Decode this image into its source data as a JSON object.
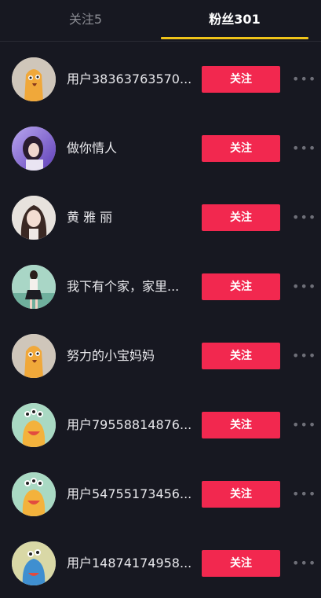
{
  "tabs": {
    "following_label": "关注5",
    "followers_label": "粉丝301"
  },
  "accent_colors": {
    "tab_underline": "#f0c419",
    "follow_button": "#f2284f"
  },
  "followers": [
    {
      "name": "用户38363763570...",
      "button_label": "关注",
      "avatar_icon": "orange-monster-avatar"
    },
    {
      "name": "做你情人",
      "button_label": "关注",
      "avatar_icon": "purple-girl-photo-avatar"
    },
    {
      "name": "黄 雅 丽",
      "button_label": "关注",
      "avatar_icon": "long-hair-girl-photo-avatar"
    },
    {
      "name": "我下有个家，家里...",
      "button_label": "关注",
      "avatar_icon": "girl-in-skirt-photo-avatar"
    },
    {
      "name": "努力的小宝妈妈",
      "button_label": "关注",
      "avatar_icon": "orange-monster-avatar"
    },
    {
      "name": "用户79558814876...",
      "button_label": "关注",
      "avatar_icon": "three-eyed-monster-avatar"
    },
    {
      "name": "用户54755173456...",
      "button_label": "关注",
      "avatar_icon": "three-eyed-monster-avatar"
    },
    {
      "name": "用户14874174958...",
      "button_label": "关注",
      "avatar_icon": "blue-monster-avatar"
    }
  ],
  "more_icon": "more-dots-icon"
}
